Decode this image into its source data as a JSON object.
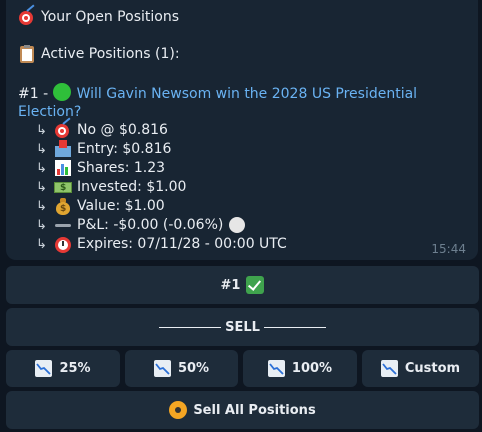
{
  "message": {
    "title": "Your Open Positions",
    "active_label": "Active Positions (1):",
    "position": {
      "index": "#1 -",
      "question": "Will Gavin Newsom win the 2028 US Presidential Election?",
      "outcome": "No @ $0.816",
      "entry": "Entry: $0.816",
      "shares": "Shares: 1.23",
      "invested": "Invested: $1.00",
      "value": "Value: $1.00",
      "pnl": "P&L: -$0.00 (-0.06%)",
      "expires": "Expires: 07/11/28 - 00:00 UTC"
    },
    "time": "15:44"
  },
  "keyboard": {
    "position_button": "#1",
    "sell_header": "SELL",
    "sell_25": "25%",
    "sell_50": "50%",
    "sell_100": "100%",
    "sell_custom": "Custom",
    "sell_all": "Sell All Positions"
  },
  "colors": {
    "background": "#0e1621",
    "bubble": "#182533",
    "link": "#6ab3f3",
    "button": "#1e2c3a"
  },
  "icons": [
    "dart-icon",
    "clipboard-icon",
    "green-circle-icon",
    "inbox-icon",
    "bar-chart-icon",
    "cash-icon",
    "money-bag-icon",
    "minus-icon",
    "white-circle-icon",
    "alarm-clock-icon",
    "check-icon",
    "chart-decreasing-icon",
    "radioactive-icon"
  ]
}
